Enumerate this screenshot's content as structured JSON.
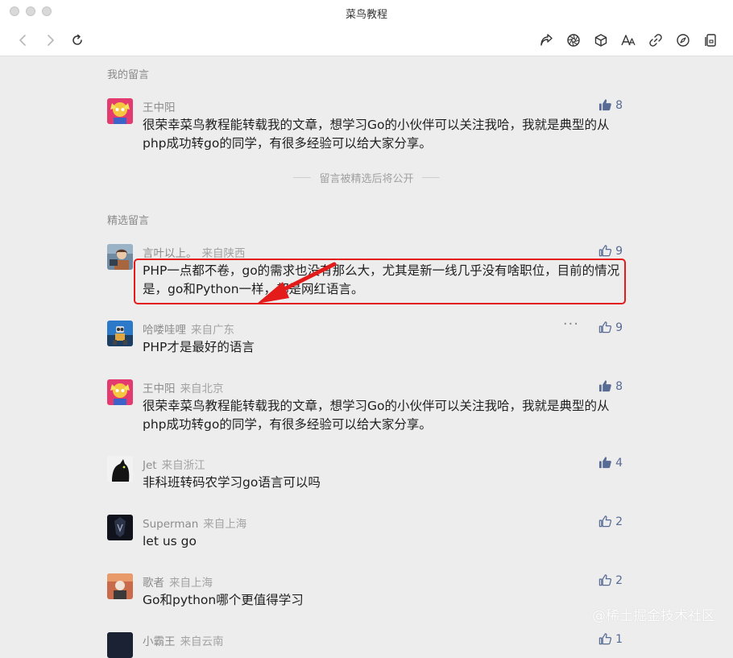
{
  "window": {
    "title": "菜鸟教程"
  },
  "toolbar": {
    "icons": [
      "back-icon",
      "forward-icon",
      "refresh-icon",
      "share-icon",
      "aperture-icon",
      "cube-icon",
      "font-size-icon",
      "link-icon",
      "compass-icon",
      "library-icon"
    ]
  },
  "my_comments": {
    "title": "我的留言",
    "items": [
      {
        "name": "王中阳",
        "location": "",
        "text": "很荣幸菜鸟教程能转载我的文章，想学习Go的小伙伴可以关注我哈，我就是典型的从php成功转go的同学，有很多经验可以给大家分享。",
        "likes": "8",
        "liked": true
      }
    ]
  },
  "divider_note": "留言被精选后将公开",
  "featured": {
    "title": "精选留言",
    "items": [
      {
        "name": "言叶以上。",
        "location": "来自陕西",
        "text": "PHP一点都不卷，go的需求也没有那么大，尤其是新一线几乎没有啥职位，目前的情况是，go和Python一样，都是网红语言。",
        "likes": "9",
        "liked": false
      },
      {
        "name": "哈喽哇哩",
        "location": "来自广东",
        "text": "PHP才是最好的语言",
        "likes": "9",
        "liked": false,
        "more": "···"
      },
      {
        "name": "王中阳",
        "location": "来自北京",
        "text": "很荣幸菜鸟教程能转载我的文章，想学习Go的小伙伴可以关注我哈，我就是典型的从php成功转go的同学，有很多经验可以给大家分享。",
        "likes": "8",
        "liked": true
      },
      {
        "name": "Jet",
        "location": "来自浙江",
        "text": "非科班转码农学习go语言可以吗",
        "likes": "4",
        "liked": true
      },
      {
        "name": "Superman",
        "location": "来自上海",
        "text": "let us go",
        "likes": "2",
        "liked": false
      },
      {
        "name": "歌者",
        "location": "来自上海",
        "text": "Go和python哪个更值得学习",
        "likes": "2",
        "liked": false
      },
      {
        "name": "小霸王",
        "location": "来自云南",
        "text": "",
        "likes": "1",
        "liked": false
      }
    ]
  },
  "watermark": "@稀土掘金技术社区",
  "colors": {
    "accent": "#576b95",
    "highlight": "#e31b1b",
    "background": "#ededed"
  }
}
